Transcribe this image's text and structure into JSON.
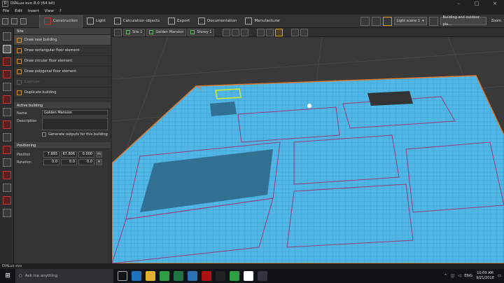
{
  "window": {
    "title": "DIALux evo 8.0  (64 bit)"
  },
  "menu": [
    "File",
    "Edit",
    "Insert",
    "View",
    "?"
  ],
  "ribbon": {
    "tabs": [
      {
        "label": "Construction"
      },
      {
        "label": "Light"
      },
      {
        "label": "Calculation objects"
      },
      {
        "label": "Export"
      },
      {
        "label": "Documentation"
      },
      {
        "label": "Manufacturer"
      }
    ],
    "light_scene": "Light scene 1",
    "view_mode": "Building and outdoor pla...",
    "zoom": "Zoom"
  },
  "panel": {
    "site_header": "Site",
    "site_items": [
      {
        "label": "Draw new building"
      },
      {
        "label": "Draw rectangular floor element"
      },
      {
        "label": "Draw circular floor element"
      },
      {
        "label": "Draw polygonal floor element"
      },
      {
        "label": "Cut/ruler"
      },
      {
        "label": "Duplicate building"
      }
    ],
    "active_header": "Active building",
    "name_label": "Name",
    "name_value": "Golden Mansion",
    "desc_label": "Description",
    "generate_label": "Generate outputs for this building",
    "positioning_header": "Positioning",
    "position_label": "Position",
    "position": [
      "7.993",
      "67.806",
      "0.000"
    ],
    "unit": "m",
    "rotation_label": "Rotation",
    "rotation": [
      "0.0",
      "0.0",
      "0.0"
    ]
  },
  "breadcrumbs": [
    "Site 1",
    "Golden Mansion",
    "Storey 1"
  ],
  "statusbar": "DIALux evo",
  "taskbar": {
    "search_placeholder": "Ask me anything",
    "time": "10:09 AM",
    "date": "9/21/2018",
    "lang": "ENG"
  },
  "colors": {
    "plan_fill": "#4fb6e6",
    "accent": "#e0a000",
    "outline": "#e07a30"
  }
}
